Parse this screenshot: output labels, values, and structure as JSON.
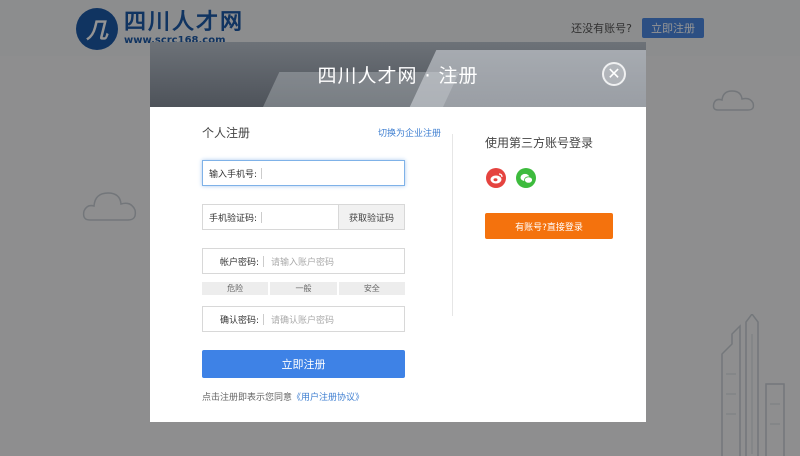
{
  "header": {
    "logo_cn": "四川人才网",
    "logo_url": "www.scrc168.com",
    "question": "还没有账号?",
    "register_button": "立即注册"
  },
  "modal": {
    "title": "四川人才网 · 注册",
    "close_icon": "close-icon",
    "personal": {
      "title": "个人注册",
      "switch_link": "切换为企业注册",
      "phone_label": "输入手机号:",
      "code_label": "手机验证码:",
      "get_code_button": "获取验证码",
      "password_label": "帐户密码:",
      "password_placeholder": "请输入账户密码",
      "strength": [
        "危险",
        "一般",
        "安全"
      ],
      "confirm_label": "确认密码:",
      "confirm_placeholder": "请确认账户密码",
      "submit_button": "立即注册",
      "agree_text": "点击注册即表示您同意",
      "agree_link": "《用户注册协议》"
    },
    "third_party": {
      "title": "使用第三方账号登录",
      "icons": [
        "weibo-icon",
        "wechat-icon"
      ],
      "login_button": "有账号?直接登录"
    }
  },
  "colors": {
    "primary": "#3e82e6",
    "orange": "#f4720d",
    "weibo": "#e5433f",
    "wechat": "#3dbb3d"
  }
}
